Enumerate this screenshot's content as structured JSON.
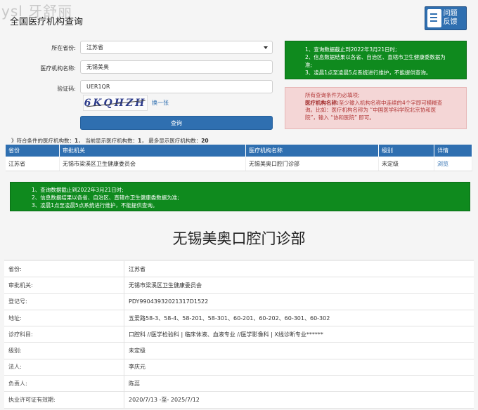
{
  "header": {
    "watermark": "ysl 牙舒丽",
    "title": "全国医疗机构查询",
    "feedback_line1": "问题",
    "feedback_line2": "反馈"
  },
  "form": {
    "province_label": "所在省份:",
    "province_value": "江苏省",
    "name_label": "医疗机构名称:",
    "name_value": "无锡美奥",
    "captcha_label": "验证码:",
    "captcha_value": "UER1QR",
    "captcha_image_text": "6KQHZH",
    "refresh_label": "换一张",
    "query_button": "查询"
  },
  "notice_top": [
    "1、查询数据截止到2022年3月21日时;",
    "2、信息数据结果以各省、自治区、直辖市卫生健康委数据为准;",
    "3、凌晨1点至凌晨5点系统进行维护，不能提供查询。"
  ],
  "notice_condition": {
    "line1": "所有查询条件为必填项;",
    "line2_key": "医疗机构名称:",
    "line2_text": "至少输入机构名称中连续的4个字即可模糊查询。比如：医疗机构名称为 “中国医学科学院北京协和医院”，输入 “协和医院” 即可。"
  },
  "summary": {
    "prefix": "》符合条件的医疗机构数：",
    "count": "1",
    "shown_label": "， 当前显示医疗机构数：",
    "shown": "1",
    "max_label": "， 最多显示医疗机构数：",
    "max": "20"
  },
  "results": {
    "headers": [
      "省份",
      "审批机关",
      "医疗机构名称",
      "级别",
      "详情"
    ],
    "row": [
      "江苏省",
      "无锡市梁溪区卫生健康委员会",
      "无锡美奥口腔门诊部",
      "未定级",
      "浏览"
    ]
  },
  "notice_bottom": [
    "1、查询数据截止到2022年3月21日时;",
    "2、信息数据结果以各省、自治区、直辖市卫生健康委数据为准;",
    "3、凌晨1点至凌晨5点系统进行维护，不能提供查询。"
  ],
  "detail": {
    "title": "无锡美奥口腔门诊部",
    "rows": [
      {
        "key": "省份:",
        "value": "江苏省"
      },
      {
        "key": "审批机关:",
        "value": "无锡市梁溪区卫生健康委员会"
      },
      {
        "key": "登记号:",
        "value": "PDY99043932021317D1522"
      },
      {
        "key": "地址:",
        "value": "五爱路58-3、58-4、58-201、58-301、60-201、60-202、60-301、60-302"
      },
      {
        "key": "诊疗科目:",
        "value": "口腔科 //医学检验科 | 临床体液、血液专业 //医学影像科 | X线诊断专业******"
      },
      {
        "key": "级别:",
        "value": "未定级"
      },
      {
        "key": "法人:",
        "value": "李庆元"
      },
      {
        "key": "负责人:",
        "value": "陈蕊"
      },
      {
        "key": "执业许可证有效期:",
        "value": "2020/7/13 -至- 2025/7/12"
      }
    ]
  },
  "colors": {
    "primary": "#2f6fb0",
    "notice_green": "#0f8a1e",
    "notice_red_bg": "#f4d6d6"
  }
}
